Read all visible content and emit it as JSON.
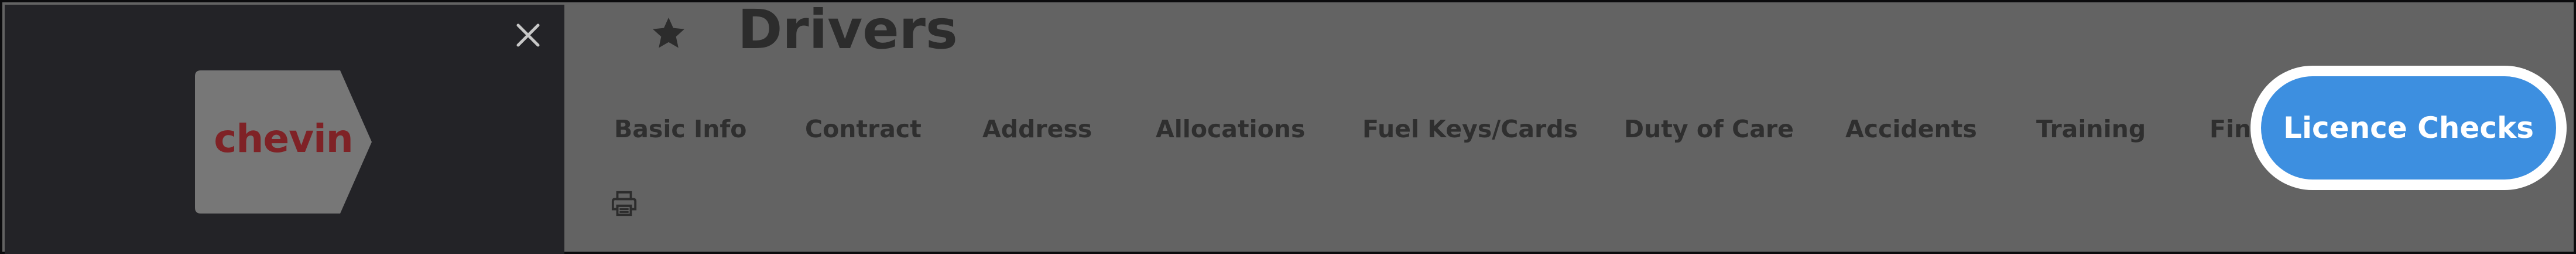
{
  "logo": {
    "text": "chevin"
  },
  "page": {
    "title": "Drivers"
  },
  "tabs": [
    {
      "label": "Basic Info"
    },
    {
      "label": "Contract"
    },
    {
      "label": "Address"
    },
    {
      "label": "Allocations"
    },
    {
      "label": "Fuel Keys/Cards"
    },
    {
      "label": "Duty of Care"
    },
    {
      "label": "Accidents"
    },
    {
      "label": "Training"
    },
    {
      "label": "Fin"
    }
  ],
  "highlight_button": {
    "label": "Licence Checks",
    "color": "#3d8fe0"
  },
  "icons": {
    "close": "close-icon",
    "favorite": "star-icon",
    "print": "printer-icon"
  },
  "colors": {
    "sidebar": "#232327",
    "overlay": "#636363",
    "brand_red": "#7f2226",
    "accent_blue": "#3d8fe0"
  }
}
